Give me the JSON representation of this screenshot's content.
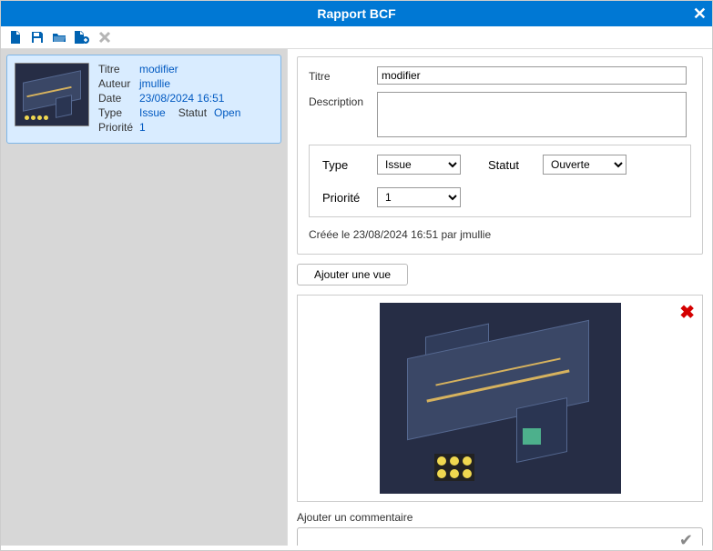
{
  "window": {
    "title": "Rapport BCF"
  },
  "list": {
    "item": {
      "titre_label": "Titre",
      "titre_value": "modifier",
      "auteur_label": "Auteur",
      "auteur_value": "jmullie",
      "date_label": "Date",
      "date_value": "23/08/2024 16:51",
      "type_label": "Type",
      "type_value": "Issue",
      "statut_label": "Statut",
      "statut_value": "Open",
      "priorite_label": "Priorité",
      "priorite_value": "1"
    }
  },
  "form": {
    "titre_label": "Titre",
    "titre_value": "modifier",
    "description_label": "Description",
    "description_value": "",
    "type_label": "Type",
    "type_value": "Issue",
    "statut_label": "Statut",
    "statut_value": "Ouverte",
    "priorite_label": "Priorité",
    "priorite_value": "1",
    "created_text": "Créée le 23/08/2024 16:51 par jmullie",
    "add_view_label": "Ajouter une vue",
    "comment_label": "Ajouter un commentaire"
  }
}
